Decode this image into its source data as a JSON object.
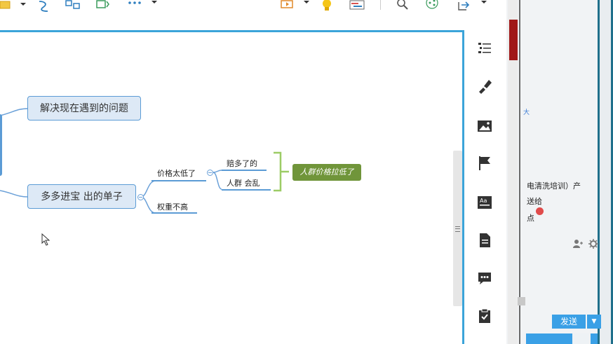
{
  "toolbar": {
    "icons": [
      "folder-icon",
      "dropdown-arrow-icon",
      "relationship-icon",
      "topic-structure-icon",
      "boundary-icon",
      "more-icon",
      "dropdown-arrow-icon",
      "presentation-icon",
      "dropdown-arrow-icon",
      "idea-lightbulb-icon",
      "gantt-icon",
      "search-icon",
      "share-icon",
      "export-icon",
      "dropdown-arrow-icon"
    ]
  },
  "mindmap": {
    "main_topics": [
      {
        "label": "解决现在遇到的问题"
      },
      {
        "label": "多多进宝  出的单子"
      }
    ],
    "subtopics": [
      {
        "label": "价格太低了"
      },
      {
        "label": "权重不高"
      }
    ],
    "leaves": [
      {
        "label": "赔多了的"
      },
      {
        "label": "人群 会乱"
      }
    ],
    "summary": {
      "label": "人群价格拉低了",
      "color": "#70953a"
    }
  },
  "side_panel": {
    "icons": [
      "outline-icon",
      "format-brush-icon",
      "image-icon",
      "flag-marker-icon",
      "font-style-icon",
      "notes-icon",
      "comment-icon",
      "task-checklist-icon"
    ]
  },
  "chat_window": {
    "lines": [
      "电清洗培训）产",
      "送给",
      "点"
    ],
    "small_mark": "大",
    "send_label": "发送",
    "send_dropdown": "▼"
  },
  "colors": {
    "accent": "#3ba4d9",
    "node_fill": "#dde9f6",
    "node_border": "#5b9bd5",
    "summary_fill": "#70953a"
  }
}
